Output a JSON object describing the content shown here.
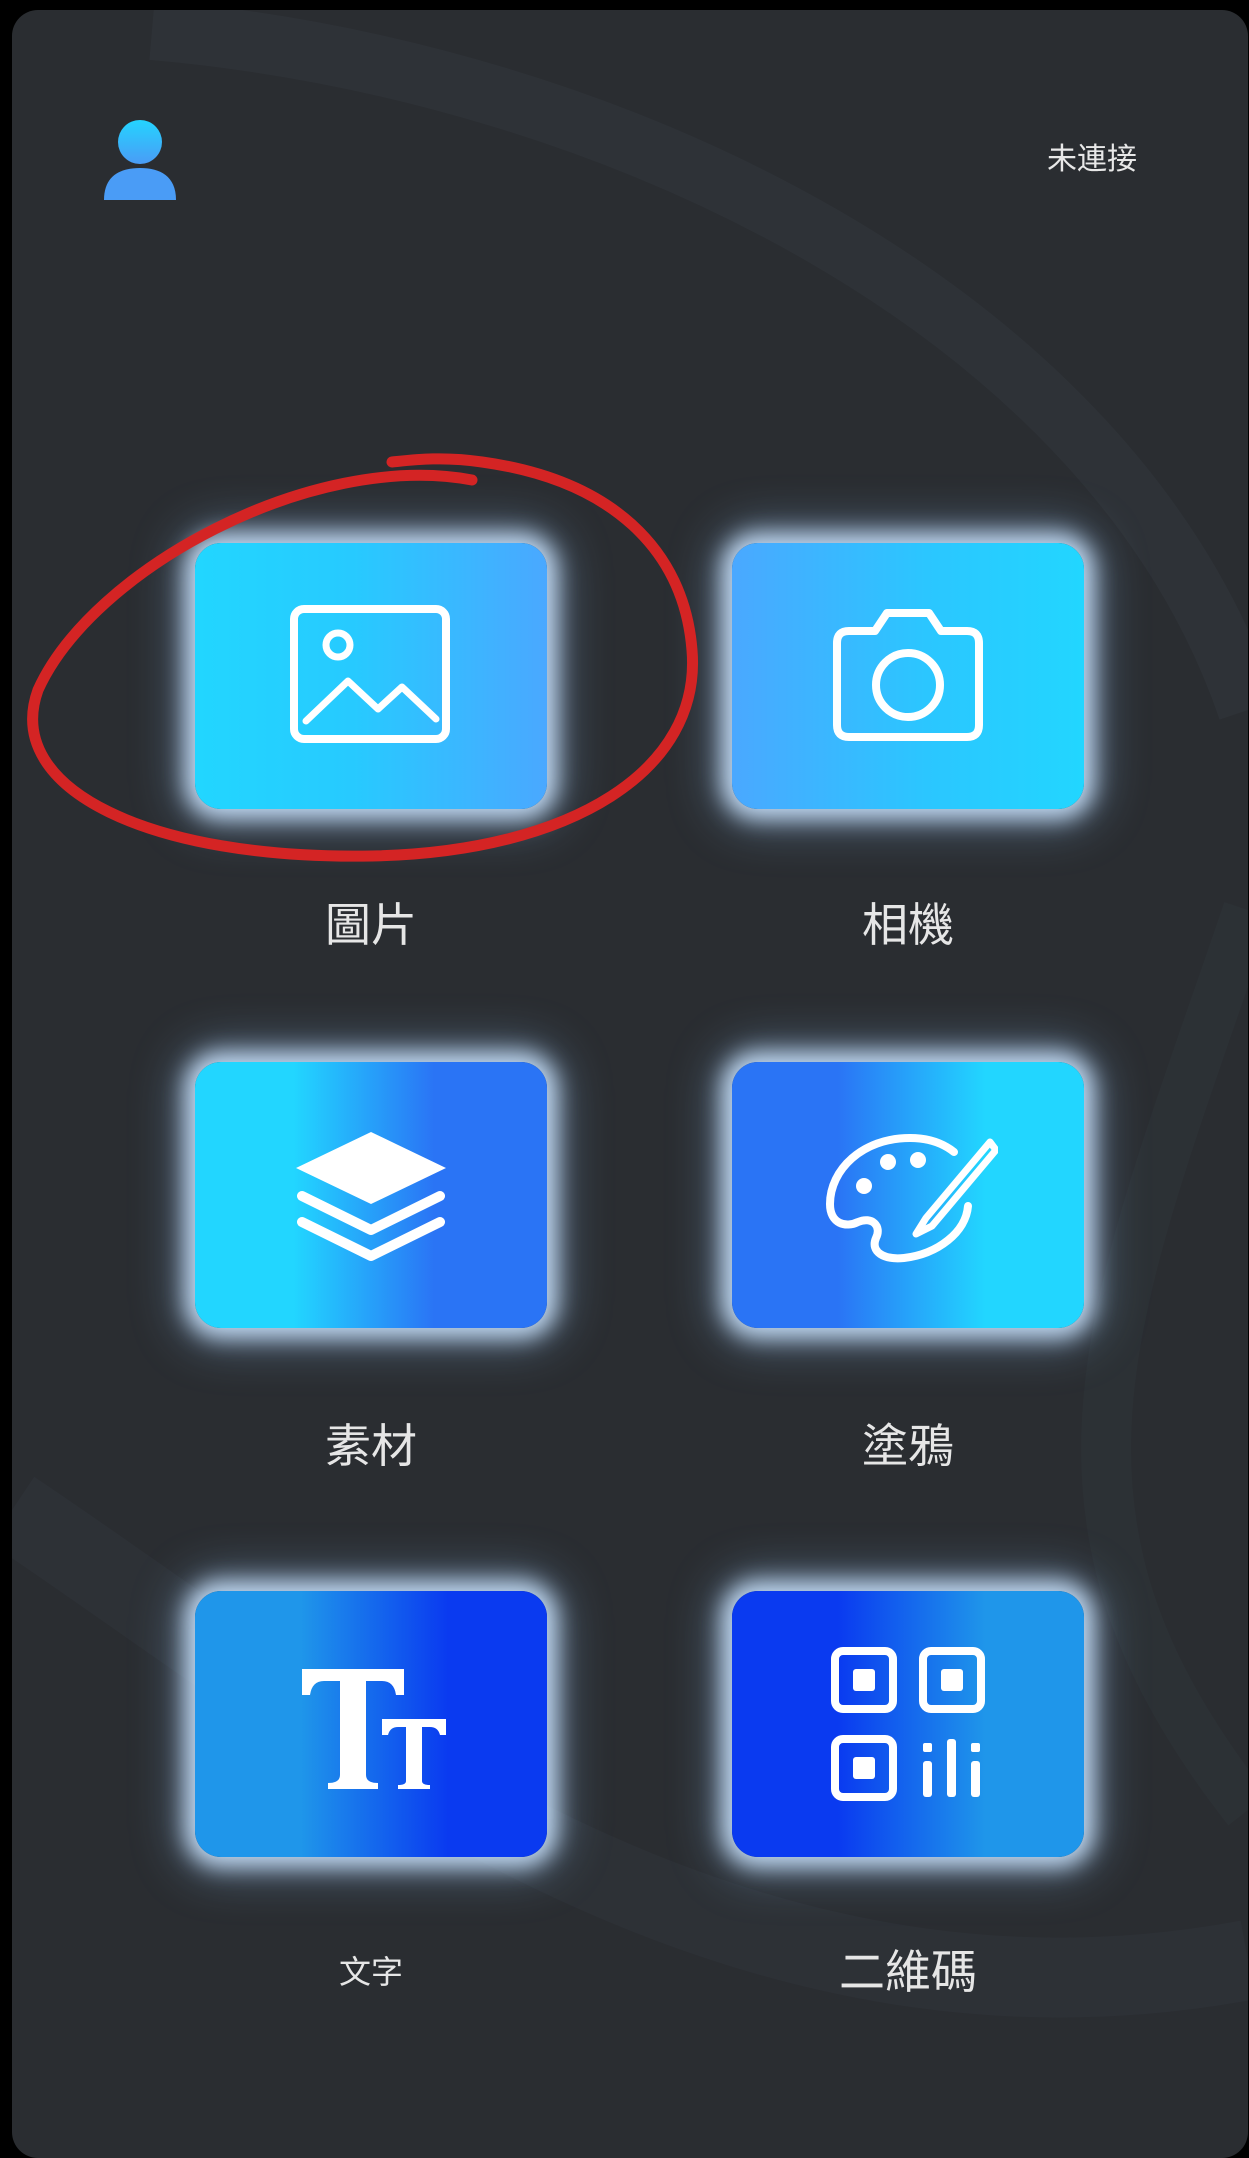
{
  "header": {
    "avatar_icon": "user-icon",
    "connection_status": "未連接"
  },
  "menu": {
    "items": [
      {
        "label": "圖片",
        "icon": "image-icon"
      },
      {
        "label": "相機",
        "icon": "camera-icon"
      },
      {
        "label": "素材",
        "icon": "layers-icon"
      },
      {
        "label": "塗鴉",
        "icon": "palette-icon"
      },
      {
        "label": "文字",
        "icon": "text-size-icon"
      },
      {
        "label": "二維碼",
        "icon": "qr-code-icon"
      }
    ]
  },
  "colors": {
    "background": "#2a2d31",
    "accent_cyan": "#22d6ff",
    "accent_blue": "#2a74f5",
    "accent_deep_blue": "#0a3af0",
    "highlight_ring": "#d42424"
  }
}
